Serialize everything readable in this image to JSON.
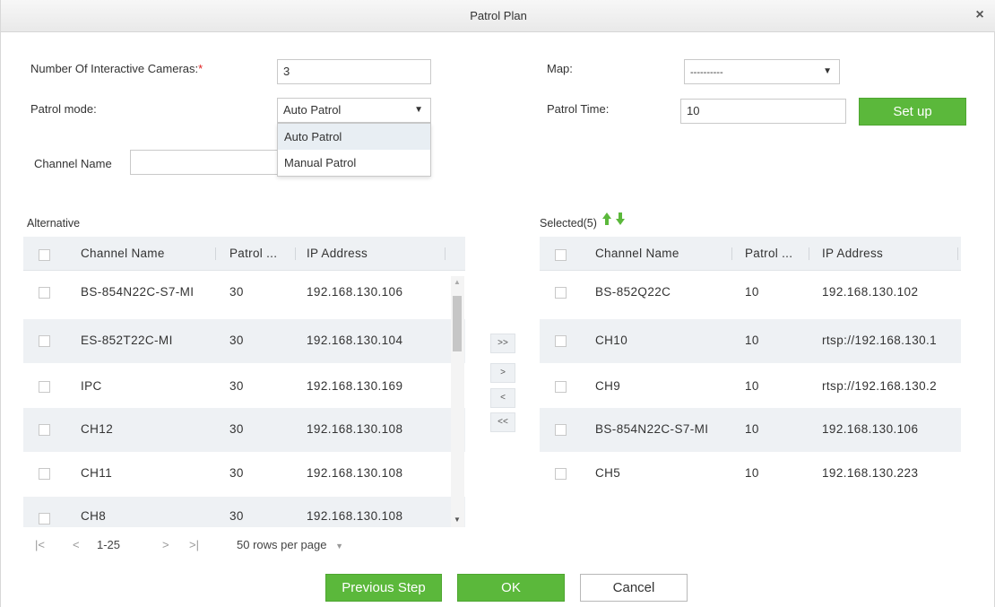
{
  "dialog": {
    "title": "Patrol Plan",
    "close_symbol": "×"
  },
  "form": {
    "cameras_label": "Number Of Interactive Cameras:",
    "cameras_required": "*",
    "cameras_value": "3",
    "patrol_mode_label": "Patrol mode:",
    "patrol_mode_value": "Auto Patrol",
    "patrol_mode_options": [
      "Auto Patrol",
      "Manual Patrol"
    ],
    "channel_name_label": "Channel Name",
    "channel_name_value": "",
    "map_label": "Map:",
    "map_value": "----------",
    "patrol_time_label": "Patrol Time:",
    "patrol_time_value": "10",
    "setup_label": "Set up"
  },
  "alternative": {
    "label": "Alternative",
    "columns": [
      "Channel Name",
      "Patrol ...",
      "IP Address"
    ],
    "rows": [
      {
        "name": "BS-854N22C-S7-MI",
        "patrol": "30",
        "ip": "192.168.130.106"
      },
      {
        "name": "ES-852T22C-MI",
        "patrol": "30",
        "ip": "192.168.130.104"
      },
      {
        "name": "IPC",
        "patrol": "30",
        "ip": "192.168.130.169"
      },
      {
        "name": "CH12",
        "patrol": "30",
        "ip": "192.168.130.108"
      },
      {
        "name": "CH11",
        "patrol": "30",
        "ip": "192.168.130.108"
      },
      {
        "name": "CH8",
        "patrol": "30",
        "ip": "192.168.130.108"
      }
    ],
    "pager": {
      "first": "|<",
      "prev": "<",
      "range": "1-25",
      "next": ">",
      "last": ">|",
      "rows_per_page": "50 rows per page"
    }
  },
  "selected": {
    "label": "Selected(5)",
    "columns": [
      "Channel Name",
      "Patrol ...",
      "IP Address"
    ],
    "rows": [
      {
        "name": "BS-852Q22C",
        "patrol": "10",
        "ip": "192.168.130.102"
      },
      {
        "name": "CH10",
        "patrol": "10",
        "ip": "rtsp://192.168.130.1"
      },
      {
        "name": "CH9",
        "patrol": "10",
        "ip": "rtsp://192.168.130.2"
      },
      {
        "name": "BS-854N22C-S7-MI",
        "patrol": "10",
        "ip": "192.168.130.106"
      },
      {
        "name": "CH5",
        "patrol": "10",
        "ip": "192.168.130.223"
      }
    ]
  },
  "move_buttons": [
    ">>",
    ">",
    "<",
    "<<"
  ],
  "footer": {
    "previous_label": "Previous Step",
    "ok_label": "OK",
    "cancel_label": "Cancel"
  },
  "icons": {
    "move_up": "arrow-up-icon",
    "move_down": "arrow-down-icon",
    "dropdown": "chevron-down-icon"
  },
  "colors": {
    "accent_green": "#5bb83b",
    "header_bg": "#eef1f4",
    "required_red": "#e02020"
  }
}
